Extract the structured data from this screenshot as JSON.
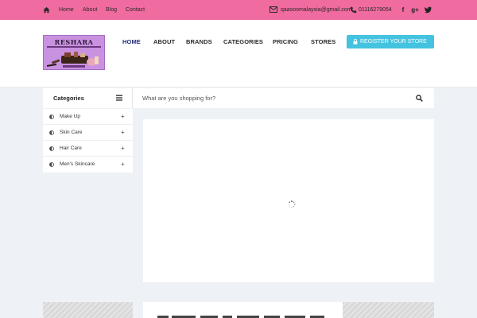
{
  "topbar": {
    "links": [
      "Home",
      "About",
      "Blog",
      "Contact"
    ],
    "email": "qaasoomalaysia@gmail.com",
    "phone": "01116279054",
    "social_icons": [
      "facebook-icon",
      "google-plus-icon",
      "twitter-icon"
    ],
    "color": "#f06b9f"
  },
  "header": {
    "logo_text": "RESHARA",
    "nav": [
      "HOME",
      "ABOUT",
      "BRANDS",
      "CATEGORIES",
      "PRICING",
      "STORES"
    ],
    "active_nav": "HOME",
    "register_label": "REGISTER YOUR STORE",
    "register_color": "#44c3e0"
  },
  "categories": {
    "title": "Categories",
    "items": [
      "Make Up",
      "Skin Care",
      "Hair Care",
      "Men's Skincare"
    ]
  },
  "search": {
    "placeholder": "What are you shopping for?"
  }
}
